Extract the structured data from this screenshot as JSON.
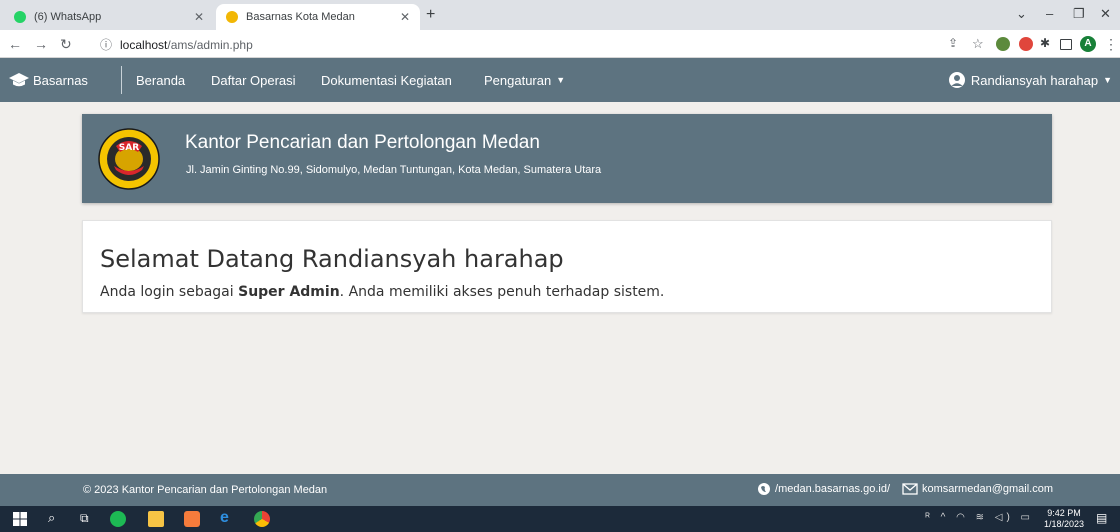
{
  "browser": {
    "tabs": [
      {
        "title": "(6) WhatsApp",
        "favicon_color": "#25d366"
      },
      {
        "title": "Basarnas Kota Medan",
        "favicon_color": "#f2b705"
      }
    ],
    "url_host": "localhost",
    "url_path": "/ams/admin.php",
    "profile_initial": "A"
  },
  "navbar": {
    "brand": "Basarnas",
    "links": [
      "Beranda",
      "Daftar Operasi",
      "Dokumentasi Kegiatan",
      "Pengaturan"
    ],
    "user": "Randiansyah harahap",
    "color": "#5d7380"
  },
  "hero": {
    "title": "Kantor Pencarian dan Pertolongan Medan",
    "address": "Jl. Jamin Ginting No.99, Sidomulyo, Medan Tuntungan, Kota Medan, Sumatera Utara"
  },
  "welcome": {
    "title": "Selamat Datang Randiansyah harahap",
    "text_before": "Anda login sebagai ",
    "role": "Super Admin",
    "text_after": ". Anda memiliki akses penuh terhadap sistem."
  },
  "footer": {
    "copyright": "© 2023 Kantor Pencarian dan Pertolongan Medan",
    "website": "/medan.basarnas.go.id/",
    "email": "komsarmedan@gmail.com"
  },
  "taskbar": {
    "time": "9:42 PM",
    "date": "1/18/2023"
  }
}
